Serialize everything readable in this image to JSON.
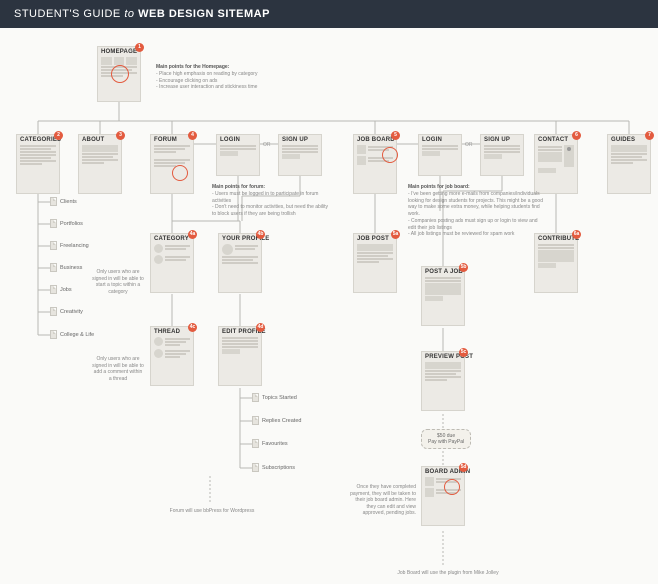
{
  "header": {
    "pre": "STUDENT'S GUIDE",
    "mid": "to",
    "post": "WEB DESIGN SITEMAP"
  },
  "nodes": {
    "homepage": {
      "t": "HOMEPAGE",
      "b": "1"
    },
    "categories": {
      "t": "CATEGORIES",
      "b": "2"
    },
    "about": {
      "t": "ABOUT",
      "b": "3"
    },
    "forum": {
      "t": "FORUM",
      "b": "4"
    },
    "login1": {
      "t": "LOGIN"
    },
    "signup1": {
      "t": "SIGN UP"
    },
    "jobboard": {
      "t": "JOB BOARD",
      "b": "5"
    },
    "login2": {
      "t": "LOGIN"
    },
    "signup2": {
      "t": "SIGN UP"
    },
    "contact": {
      "t": "CONTACT",
      "b": "6"
    },
    "guides": {
      "t": "GUIDES",
      "b": "7"
    },
    "category": {
      "t": "CATEGORY",
      "b": "4a"
    },
    "yourprofile": {
      "t": "YOUR PROFILE",
      "b": "4b"
    },
    "jobpost": {
      "t": "JOB POST",
      "b": "5a"
    },
    "contribute": {
      "t": "CONTRIBUTE",
      "b": "6a"
    },
    "thread": {
      "t": "THREAD",
      "b": "4c"
    },
    "editprofile": {
      "t": "EDIT PROFILE",
      "b": "4d"
    },
    "postajob": {
      "t": "POST A JOB",
      "b": "5b"
    },
    "previewpost": {
      "t": "PREVIEW POST",
      "b": "5c"
    },
    "boardadmin": {
      "t": "BOARD ADMIN",
      "b": "5d"
    }
  },
  "notes": {
    "homepage": {
      "h": "Main points for the Homepage:",
      "l1": "- Place high emphasis on reading by category",
      "l2": "- Encourage clicking on ads",
      "l3": "- Increase user interaction and stickiness time"
    },
    "forum": {
      "h": "Main points for forum:",
      "l1": "- Users must be logged in to participate in forum activities",
      "l2": "- Don't need to monitor activities, but need the ability to block users if they are being trollish"
    },
    "jobboard": {
      "h": "Main points for job board:",
      "l1": "- I've been getting more e-mails from companies/individuals looking for design students for projects. This might be a good way to make some extra money, while helping students find work.",
      "l2": "- Companies posting ads must sign up or login to view and edit their job listings",
      "l3": "- All job listings must be reviewed for spam work"
    }
  },
  "catLeaves": {
    "a": "Clients",
    "b": "Portfolios",
    "c": "Freelancing",
    "d": "Business",
    "e": "Jobs",
    "f": "Creativity",
    "g": "College & Life"
  },
  "profLeaves": {
    "a": "Topics Started",
    "b": "Replies Created",
    "c": "Favourites",
    "d": "Subscriptions"
  },
  "side": {
    "cat": "Only users who are signed in will be able to start a topic within a category",
    "thread": "Only users who are signed in will be able to add a comment within a thread",
    "admin": "Once they have completed payment, they will be taken to their job board admin. Here they can edit and view approved, pending jobs."
  },
  "or": "OR",
  "pay": {
    "l1": "$50 due",
    "l2": "Pay with PayPal"
  },
  "foot": {
    "forum": "Forum will use bbPress for Wordpress",
    "job": "Job Board will use the plugin from Mike Jolley"
  }
}
